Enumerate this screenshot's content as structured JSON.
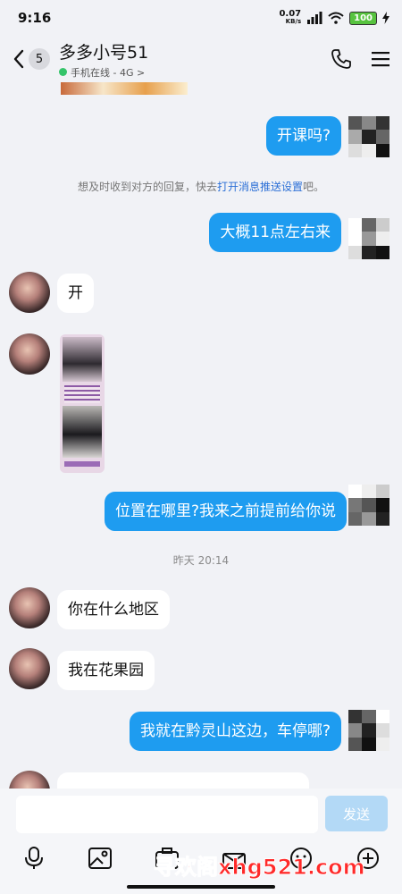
{
  "status_bar": {
    "time": "9:16",
    "net_speed_value": "0.07",
    "net_speed_unit": "KB/s",
    "battery": "100"
  },
  "header": {
    "back_badge": "5",
    "title": "多多小号51",
    "status": "手机在线 - 4G >",
    "icons": [
      "back-chevron-icon",
      "phone-icon",
      "menu-icon"
    ]
  },
  "messages": [
    {
      "from": "me",
      "text": "开课吗?"
    },
    {
      "type": "system",
      "text_before": "想及时收到对方的回复，快去",
      "link": "打开消息推送设置",
      "text_after": "吧。"
    },
    {
      "from": "me",
      "text": "大概11点左右来"
    },
    {
      "from": "them",
      "text": "开"
    },
    {
      "from": "them",
      "type": "image"
    },
    {
      "from": "me",
      "text": "位置在哪里?我来之前提前给你说"
    },
    {
      "type": "timestamp",
      "text": "昨天 20:14"
    },
    {
      "from": "them",
      "text": "你在什么地区"
    },
    {
      "from": "them",
      "text": "我在花果园"
    },
    {
      "from": "me",
      "text": "我就在黔灵山这边，车停哪?"
    }
  ],
  "input": {
    "placeholder": "",
    "send_label": "发送"
  },
  "toolbar": [
    "mic-icon",
    "image-icon",
    "camera-icon",
    "gift-icon",
    "emoji-icon",
    "plus-icon"
  ],
  "watermark": "寻欢阁xhg521.com",
  "colors": {
    "outgoing_bubble": "#1e9cf0",
    "incoming_bubble": "#ffffff",
    "background": "#f1f2f6",
    "link": "#2b6fd6",
    "online_dot": "#35c46a",
    "watermark": "#ff2a2a"
  }
}
